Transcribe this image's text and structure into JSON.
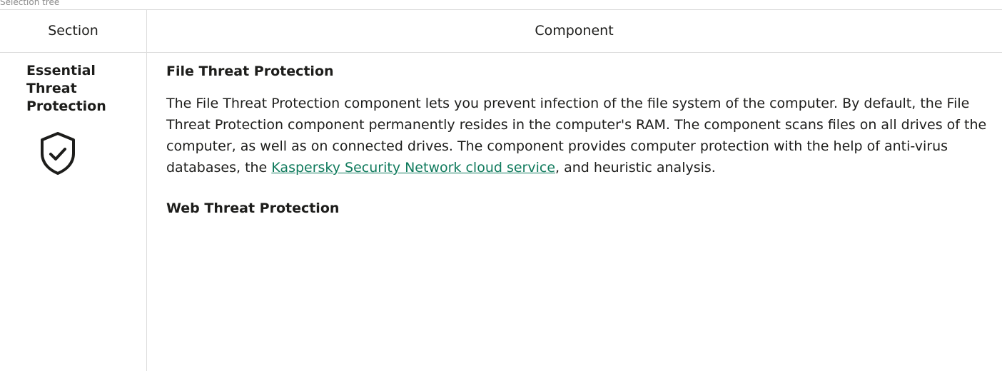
{
  "caption": "Selection tree",
  "table": {
    "headers": {
      "section": "Section",
      "component": "Component"
    },
    "rows": [
      {
        "section": "Essential Threat Protection",
        "section_icon": "shield-check-icon",
        "components": [
          {
            "title": "File Threat Protection",
            "desc_before": "The File Threat Protection component lets you prevent infection of the file system of the computer. By default, the File Threat Protection component permanently resides in the computer's RAM. The component scans files on all drives of the computer, as well as on connected drives. The component provides computer protection with the help of anti-virus databases, the ",
            "link": "Kaspersky Security Network cloud service",
            "desc_after": ", and heuristic analysis."
          },
          {
            "title": "Web Threat Protection"
          }
        ]
      }
    ]
  },
  "colors": {
    "link": "#0f7a5c",
    "border": "#dcdcdc",
    "text": "#1d1d1b"
  }
}
